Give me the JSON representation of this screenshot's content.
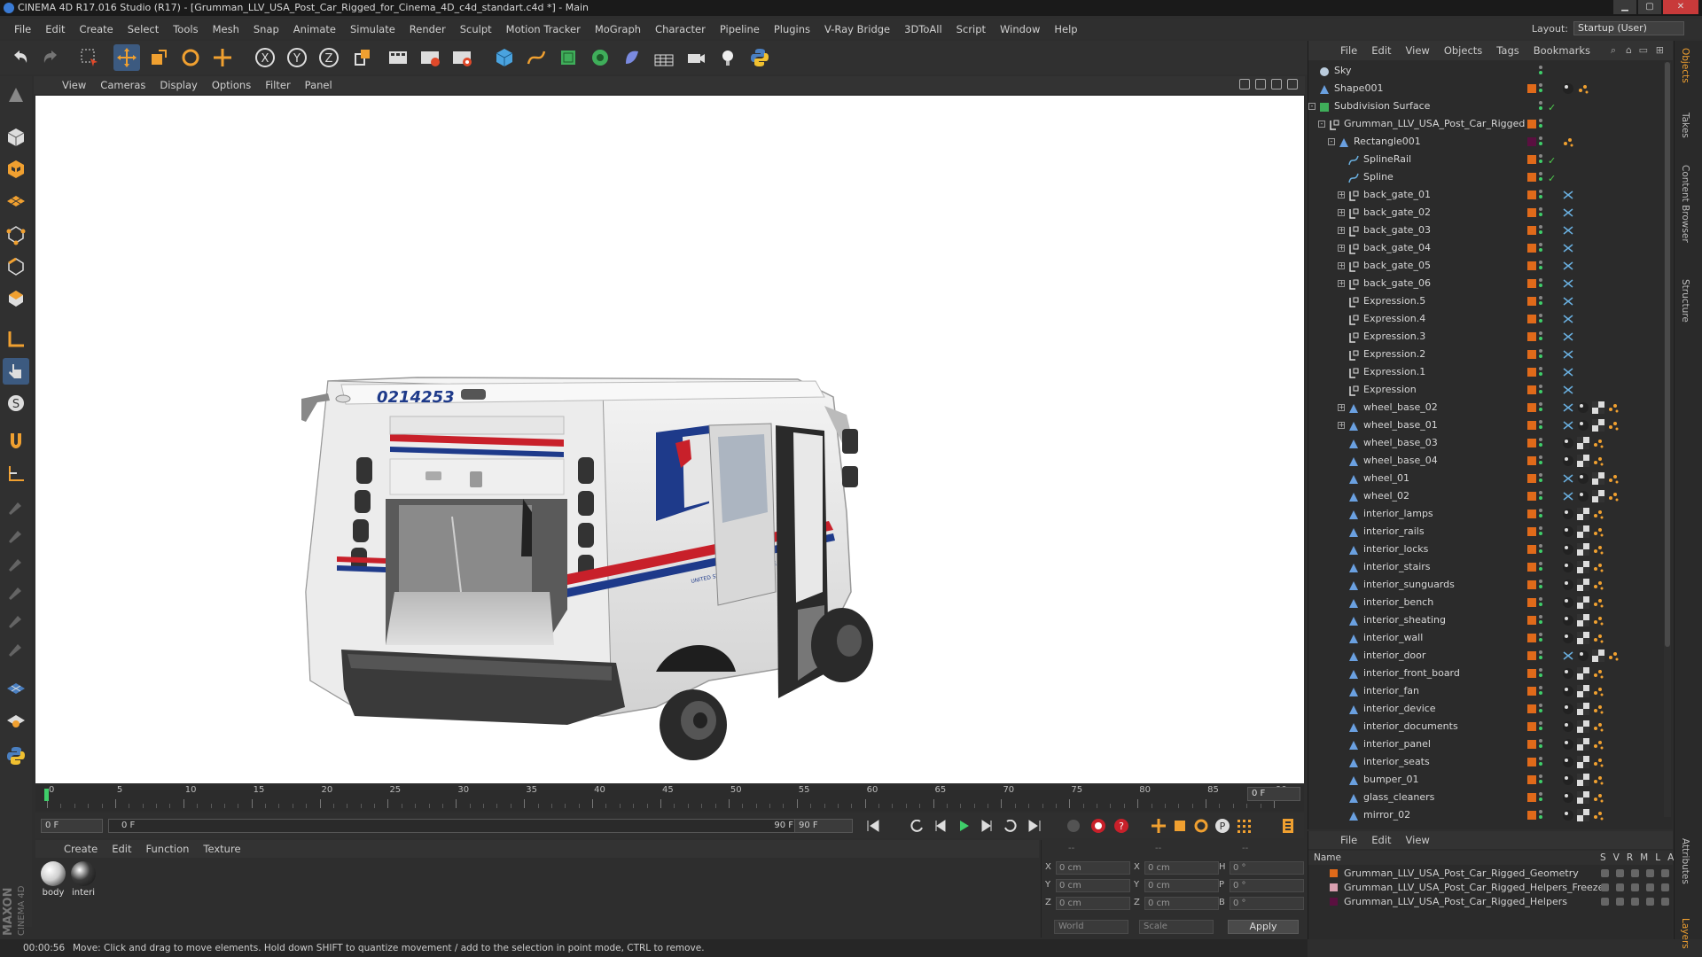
{
  "window": {
    "title": "CINEMA 4D R17.016 Studio (R17) - [Grumman_LLV_USA_Post_Car_Rigged_for_Cinema_4D_c4d_standart.c4d *] - Main"
  },
  "menubar": {
    "items": [
      "File",
      "Edit",
      "Create",
      "Select",
      "Tools",
      "Mesh",
      "Snap",
      "Animate",
      "Simulate",
      "Render",
      "Sculpt",
      "Motion Tracker",
      "MoGraph",
      "Character",
      "Pipeline",
      "Plugins",
      "V-Ray Bridge",
      "3DToAll",
      "Script",
      "Window",
      "Help"
    ],
    "layout_label": "Layout:",
    "layout_value": "Startup (User)"
  },
  "viewport": {
    "menu": [
      "View",
      "Cameras",
      "Display",
      "Options",
      "Filter",
      "Panel"
    ],
    "truck_number": "0214253",
    "side_text": "UNITED STATES POSTAL SERVICE"
  },
  "timeline": {
    "ticks": [
      "0",
      "5",
      "10",
      "15",
      "20",
      "25",
      "30",
      "35",
      "40",
      "45",
      "50",
      "55",
      "60",
      "65",
      "70",
      "75",
      "80",
      "85",
      "90"
    ],
    "current_frame": "0 F",
    "start_field": "0 F",
    "range_start": "0 F",
    "range_end": "90 F",
    "end_field": "90 F"
  },
  "materials": {
    "menu": [
      "Create",
      "Edit",
      "Function",
      "Texture"
    ],
    "items": [
      {
        "name": "body",
        "color": "#cfcfcf"
      },
      {
        "name": "interi",
        "color": "#3a3a3a"
      }
    ]
  },
  "coordinates": {
    "header": [
      "--",
      "--",
      "--"
    ],
    "rows": [
      {
        "a_label": "X",
        "a_value": "0 cm",
        "b_label": "X",
        "b_value": "0 cm",
        "c_label": "H",
        "c_value": "0 °"
      },
      {
        "a_label": "Y",
        "a_value": "0 cm",
        "b_label": "Y",
        "b_value": "0 cm",
        "c_label": "P",
        "c_value": "0 °"
      },
      {
        "a_label": "Z",
        "a_value": "0 cm",
        "b_label": "Z",
        "b_value": "0 cm",
        "c_label": "B",
        "c_value": "0 °"
      }
    ],
    "space": "World",
    "mode": "Scale",
    "apply_label": "Apply"
  },
  "status": {
    "time": "00:00:56",
    "message": "Move: Click and drag to move elements. Hold down SHIFT to quantize movement / add to the selection in point mode, CTRL to remove."
  },
  "objects": {
    "menu": [
      "File",
      "Edit",
      "View",
      "Objects",
      "Tags",
      "Bookmarks"
    ],
    "rows": [
      {
        "name": "Sky",
        "indent": 0,
        "icon": "sky-icon",
        "expand": "",
        "layer": "none",
        "check": "",
        "tags": []
      },
      {
        "name": "Shape001",
        "indent": 0,
        "icon": "polygon-icon",
        "expand": "",
        "layer": "orange",
        "check": "",
        "tags": [
          "material",
          "dots"
        ]
      },
      {
        "name": "Subdivision Surface",
        "indent": 0,
        "icon": "subdivision-icon",
        "expand": "-",
        "layer": "none",
        "check": "✓",
        "tags": []
      },
      {
        "name": "Grumman_LLV_USA_Post_Car_Rigged",
        "indent": 1,
        "icon": "null-icon",
        "expand": "-",
        "layer": "orange",
        "check": "",
        "tags": []
      },
      {
        "name": "Rectangle001",
        "indent": 2,
        "icon": "polygon-icon",
        "expand": "-",
        "layer": "purple",
        "check": "",
        "tags": [
          "dots"
        ]
      },
      {
        "name": "SplineRail",
        "indent": 3,
        "icon": "spline-icon",
        "expand": "",
        "layer": "orange",
        "check": "✓",
        "tags": []
      },
      {
        "name": "Spline",
        "indent": 3,
        "icon": "spline-icon",
        "expand": "",
        "layer": "orange",
        "check": "✓",
        "tags": []
      },
      {
        "name": "back_gate_01",
        "indent": 3,
        "icon": "null-icon",
        "expand": "+",
        "layer": "orange",
        "check": "",
        "tags": [
          "xpresso"
        ]
      },
      {
        "name": "back_gate_02",
        "indent": 3,
        "icon": "null-icon",
        "expand": "+",
        "layer": "orange",
        "check": "",
        "tags": [
          "xpresso"
        ]
      },
      {
        "name": "back_gate_03",
        "indent": 3,
        "icon": "null-icon",
        "expand": "+",
        "layer": "orange",
        "check": "",
        "tags": [
          "xpresso"
        ]
      },
      {
        "name": "back_gate_04",
        "indent": 3,
        "icon": "null-icon",
        "expand": "+",
        "layer": "orange",
        "check": "",
        "tags": [
          "xpresso"
        ]
      },
      {
        "name": "back_gate_05",
        "indent": 3,
        "icon": "null-icon",
        "expand": "+",
        "layer": "orange",
        "check": "",
        "tags": [
          "xpresso"
        ]
      },
      {
        "name": "back_gate_06",
        "indent": 3,
        "icon": "null-icon",
        "expand": "+",
        "layer": "orange",
        "check": "",
        "tags": [
          "xpresso"
        ]
      },
      {
        "name": "Expression.5",
        "indent": 3,
        "icon": "null-icon",
        "expand": "",
        "layer": "orange",
        "check": "",
        "tags": [
          "xpresso"
        ]
      },
      {
        "name": "Expression.4",
        "indent": 3,
        "icon": "null-icon",
        "expand": "",
        "layer": "orange",
        "check": "",
        "tags": [
          "xpresso"
        ]
      },
      {
        "name": "Expression.3",
        "indent": 3,
        "icon": "null-icon",
        "expand": "",
        "layer": "orange",
        "check": "",
        "tags": [
          "xpresso"
        ]
      },
      {
        "name": "Expression.2",
        "indent": 3,
        "icon": "null-icon",
        "expand": "",
        "layer": "orange",
        "check": "",
        "tags": [
          "xpresso"
        ]
      },
      {
        "name": "Expression.1",
        "indent": 3,
        "icon": "null-icon",
        "expand": "",
        "layer": "orange",
        "check": "",
        "tags": [
          "xpresso"
        ]
      },
      {
        "name": "Expression",
        "indent": 3,
        "icon": "null-icon",
        "expand": "",
        "layer": "orange",
        "check": "",
        "tags": [
          "xpresso"
        ]
      },
      {
        "name": "wheel_base_02",
        "indent": 3,
        "icon": "polygon-icon",
        "expand": "+",
        "layer": "orange",
        "check": "",
        "tags": [
          "xpresso",
          "material",
          "checker",
          "dots"
        ]
      },
      {
        "name": "wheel_base_01",
        "indent": 3,
        "icon": "polygon-icon",
        "expand": "+",
        "layer": "orange",
        "check": "",
        "tags": [
          "xpresso",
          "material",
          "checker",
          "dots"
        ]
      },
      {
        "name": "wheel_base_03",
        "indent": 3,
        "icon": "polygon-icon",
        "expand": "",
        "layer": "orange",
        "check": "",
        "tags": [
          "material",
          "checker",
          "dots"
        ]
      },
      {
        "name": "wheel_base_04",
        "indent": 3,
        "icon": "polygon-icon",
        "expand": "",
        "layer": "orange",
        "check": "",
        "tags": [
          "material",
          "checker",
          "dots"
        ]
      },
      {
        "name": "wheel_01",
        "indent": 3,
        "icon": "polygon-icon",
        "expand": "",
        "layer": "orange",
        "check": "",
        "tags": [
          "xpresso",
          "material",
          "checker",
          "dots"
        ]
      },
      {
        "name": "wheel_02",
        "indent": 3,
        "icon": "polygon-icon",
        "expand": "",
        "layer": "orange",
        "check": "",
        "tags": [
          "xpresso",
          "material",
          "checker",
          "dots"
        ]
      },
      {
        "name": "interior_lamps",
        "indent": 3,
        "icon": "polygon-icon",
        "expand": "",
        "layer": "orange",
        "check": "",
        "tags": [
          "material",
          "checker",
          "dots"
        ]
      },
      {
        "name": "interior_rails",
        "indent": 3,
        "icon": "polygon-icon",
        "expand": "",
        "layer": "orange",
        "check": "",
        "tags": [
          "material",
          "checker",
          "dots"
        ]
      },
      {
        "name": "interior_locks",
        "indent": 3,
        "icon": "polygon-icon",
        "expand": "",
        "layer": "orange",
        "check": "",
        "tags": [
          "material",
          "checker",
          "dots"
        ]
      },
      {
        "name": "interior_stairs",
        "indent": 3,
        "icon": "polygon-icon",
        "expand": "",
        "layer": "orange",
        "check": "",
        "tags": [
          "material",
          "checker",
          "dots"
        ]
      },
      {
        "name": "interior_sunguards",
        "indent": 3,
        "icon": "polygon-icon",
        "expand": "",
        "layer": "orange",
        "check": "",
        "tags": [
          "material",
          "checker",
          "dots"
        ]
      },
      {
        "name": "interior_bench",
        "indent": 3,
        "icon": "polygon-icon",
        "expand": "",
        "layer": "orange",
        "check": "",
        "tags": [
          "material",
          "checker",
          "dots"
        ]
      },
      {
        "name": "interior_sheating",
        "indent": 3,
        "icon": "polygon-icon",
        "expand": "",
        "layer": "orange",
        "check": "",
        "tags": [
          "material",
          "checker",
          "dots"
        ]
      },
      {
        "name": "interior_wall",
        "indent": 3,
        "icon": "polygon-icon",
        "expand": "",
        "layer": "orange",
        "check": "",
        "tags": [
          "material",
          "checker",
          "dots"
        ]
      },
      {
        "name": "interior_door",
        "indent": 3,
        "icon": "polygon-icon",
        "expand": "",
        "layer": "orange",
        "check": "",
        "tags": [
          "xpresso",
          "material",
          "checker",
          "dots"
        ]
      },
      {
        "name": "interior_front_board",
        "indent": 3,
        "icon": "polygon-icon",
        "expand": "",
        "layer": "orange",
        "check": "",
        "tags": [
          "material",
          "checker",
          "dots"
        ]
      },
      {
        "name": "interior_fan",
        "indent": 3,
        "icon": "polygon-icon",
        "expand": "",
        "layer": "orange",
        "check": "",
        "tags": [
          "material",
          "checker",
          "dots"
        ]
      },
      {
        "name": "interior_device",
        "indent": 3,
        "icon": "polygon-icon",
        "expand": "",
        "layer": "orange",
        "check": "",
        "tags": [
          "material",
          "checker",
          "dots"
        ]
      },
      {
        "name": "interior_documents",
        "indent": 3,
        "icon": "polygon-icon",
        "expand": "",
        "layer": "orange",
        "check": "",
        "tags": [
          "material",
          "checker",
          "dots"
        ]
      },
      {
        "name": "interior_panel",
        "indent": 3,
        "icon": "polygon-icon",
        "expand": "",
        "layer": "orange",
        "check": "",
        "tags": [
          "material",
          "checker",
          "dots"
        ]
      },
      {
        "name": "interior_seats",
        "indent": 3,
        "icon": "polygon-icon",
        "expand": "",
        "layer": "orange",
        "check": "",
        "tags": [
          "material",
          "checker",
          "dots"
        ]
      },
      {
        "name": "bumper_01",
        "indent": 3,
        "icon": "polygon-icon",
        "expand": "",
        "layer": "orange",
        "check": "",
        "tags": [
          "material",
          "checker",
          "dots"
        ]
      },
      {
        "name": "glass_cleaners",
        "indent": 3,
        "icon": "polygon-icon",
        "expand": "",
        "layer": "orange",
        "check": "",
        "tags": [
          "material",
          "checker",
          "dots"
        ]
      },
      {
        "name": "mirror_02",
        "indent": 3,
        "icon": "polygon-icon",
        "expand": "",
        "layer": "orange",
        "check": "",
        "tags": [
          "material",
          "checker",
          "dots"
        ]
      }
    ]
  },
  "layers": {
    "menu": [
      "File",
      "Edit",
      "View"
    ],
    "header_name": "Name",
    "header_cols": [
      "S",
      "V",
      "R",
      "M",
      "L",
      "A"
    ],
    "rows": [
      {
        "name": "Grumman_LLV_USA_Post_Car_Rigged_Geometry",
        "color": "#e06a1a"
      },
      {
        "name": "Grumman_LLV_USA_Post_Car_Rigged_Helpers_Freeze",
        "color": "#d9a0b0"
      },
      {
        "name": "Grumman_LLV_USA_Post_Car_Rigged_Helpers",
        "color": "#5a1040"
      }
    ]
  },
  "side_tabs": [
    "Objects",
    "Takes",
    "Content Browser",
    "Structure"
  ],
  "side_tabs_bottom": [
    "Attributes",
    "Layers"
  ],
  "colors": {
    "accent_orange": "#f0a030",
    "layer_orange": "#e06a1a",
    "usps_red": "#c8202a",
    "usps_blue": "#1e3a8a"
  }
}
